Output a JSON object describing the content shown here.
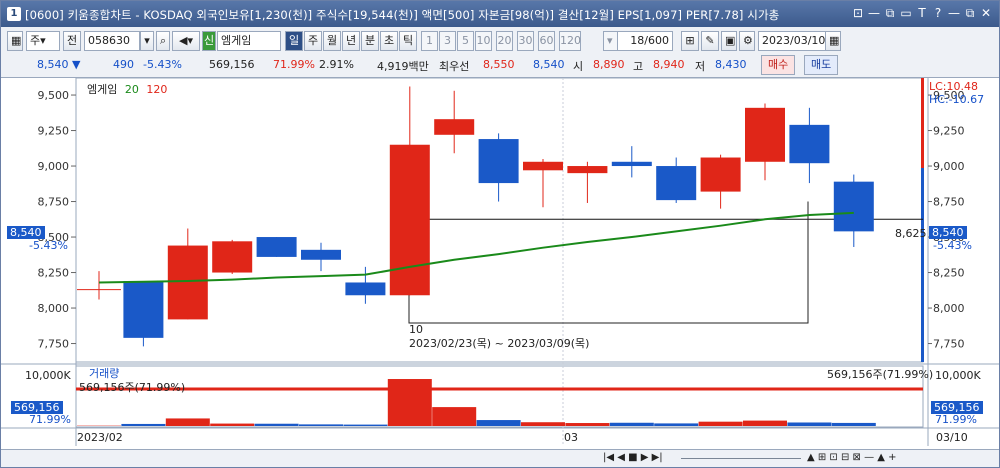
{
  "window": {
    "index": "1",
    "title": "[0600] 키움종합차트 - KOSDAQ 외국인보유[1,230(천)] 주식수[19,544(천)] 액면[500] 자본금[98(억)] 결산[12월] EPS[1,097] PER[7.78] 시가총",
    "buttons": [
      "⊡",
      "—",
      "⧉",
      "▭",
      "T",
      "?",
      "—",
      "⧉",
      "✕"
    ]
  },
  "toolbar": {
    "mode_label": "주",
    "prev_label": "전",
    "code": "058630",
    "name": "엠게임",
    "new_badge": "신",
    "periods": [
      "일",
      "주",
      "월",
      "년",
      "분",
      "초",
      "틱"
    ],
    "active_period": "일",
    "intervals": [
      "1",
      "3",
      "5",
      "10",
      "20",
      "30",
      "60",
      "120"
    ],
    "count": "18/600",
    "date": "2023/03/10"
  },
  "info": {
    "price": "8,540",
    "arrow": "▼",
    "change": "490",
    "change_pct": "-5.43%",
    "volume": "569,156",
    "vol_pct": "71.99%",
    "turnover": "2.91%",
    "amount": "4,919백만",
    "pref_label": "최우선",
    "pref_ask": "8,550",
    "pref_bid": "8,540",
    "open_label": "시",
    "open": "8,890",
    "high_label": "고",
    "high": "8,940",
    "low_label": "저",
    "low": "8,430",
    "buy_label": "매수",
    "sell_label": "매도"
  },
  "price_panel": {
    "legend_name": "엠게임",
    "ma1": "20",
    "ma2": "120",
    "lc": "LC:10.48",
    "hc": "HC:-10.67",
    "current_tag": "8,540",
    "current_pct": "-5.43%",
    "ref_label": "8,625",
    "range_count": "10",
    "range_text": "2023/02/23(목) ~ 2023/03/09(목)"
  },
  "volume_panel": {
    "title": "거래량",
    "max_label": "10,000K",
    "legend": "569,156주(71.99%)",
    "right_legend": "569,156주(71.99%)",
    "current_tag": "569,156",
    "current_pct": "71.99%"
  },
  "x_axis": {
    "labels": [
      "2023/02",
      "03"
    ],
    "right_date": "03/10"
  },
  "chart_data": {
    "type": "candlestick",
    "y_ticks": [
      7750,
      8000,
      8250,
      8500,
      8750,
      9000,
      9250,
      9500
    ],
    "ylim": [
      7620,
      9620
    ],
    "volume_max": 10000000,
    "candles": [
      {
        "o": 8130,
        "h": 8260,
        "l": 8060,
        "c": 8130,
        "v": 60000
      },
      {
        "o": 8190,
        "h": 8190,
        "l": 7730,
        "c": 7790,
        "v": 380000
      },
      {
        "o": 7920,
        "h": 8560,
        "l": 7920,
        "c": 8440,
        "v": 1400000
      },
      {
        "o": 8250,
        "h": 8480,
        "l": 8240,
        "c": 8470,
        "v": 450000
      },
      {
        "o": 8500,
        "h": 8500,
        "l": 8360,
        "c": 8360,
        "v": 420000
      },
      {
        "o": 8410,
        "h": 8460,
        "l": 8260,
        "c": 8340,
        "v": 300000
      },
      {
        "o": 8180,
        "h": 8290,
        "l": 8030,
        "c": 8090,
        "v": 260000
      },
      {
        "o": 8090,
        "h": 9560,
        "l": 8090,
        "c": 9150,
        "v": 8700000
      },
      {
        "o": 9220,
        "h": 9530,
        "l": 9090,
        "c": 9330,
        "v": 3500000
      },
      {
        "o": 9190,
        "h": 9230,
        "l": 8750,
        "c": 8880,
        "v": 1100000
      },
      {
        "o": 8970,
        "h": 9050,
        "l": 8710,
        "c": 9030,
        "v": 700000
      },
      {
        "o": 8950,
        "h": 9030,
        "l": 8740,
        "c": 9000,
        "v": 550000
      },
      {
        "o": 9030,
        "h": 9140,
        "l": 8920,
        "c": 9000,
        "v": 600000
      },
      {
        "o": 9000,
        "h": 9060,
        "l": 8740,
        "c": 8760,
        "v": 480000
      },
      {
        "o": 8820,
        "h": 9080,
        "l": 8700,
        "c": 9060,
        "v": 800000
      },
      {
        "o": 9030,
        "h": 9440,
        "l": 8900,
        "c": 9410,
        "v": 1000000
      },
      {
        "o": 9290,
        "h": 9410,
        "l": 8880,
        "c": 9020,
        "v": 650000
      },
      {
        "o": 8890,
        "h": 8940,
        "l": 8430,
        "c": 8540,
        "v": 569156
      }
    ],
    "ma20": [
      8180,
      8185,
      8190,
      8200,
      8215,
      8225,
      8235,
      8290,
      8340,
      8380,
      8425,
      8465,
      8500,
      8540,
      8580,
      8625,
      8655,
      8670
    ]
  }
}
